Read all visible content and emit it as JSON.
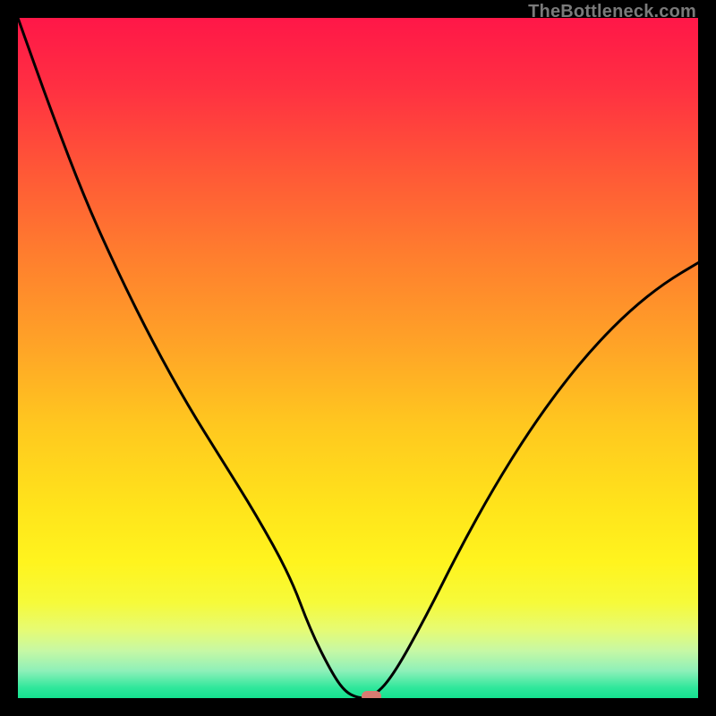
{
  "watermark": "TheBottleneck.com",
  "gradient": {
    "stops": [
      {
        "offset": 0.0,
        "color": "#ff1748"
      },
      {
        "offset": 0.1,
        "color": "#ff2f42"
      },
      {
        "offset": 0.22,
        "color": "#ff5637"
      },
      {
        "offset": 0.35,
        "color": "#ff7e2e"
      },
      {
        "offset": 0.48,
        "color": "#ffa327"
      },
      {
        "offset": 0.6,
        "color": "#ffc81f"
      },
      {
        "offset": 0.72,
        "color": "#ffe41b"
      },
      {
        "offset": 0.8,
        "color": "#fff41e"
      },
      {
        "offset": 0.86,
        "color": "#f6fa3a"
      },
      {
        "offset": 0.9,
        "color": "#e6fb74"
      },
      {
        "offset": 0.93,
        "color": "#c7f8a4"
      },
      {
        "offset": 0.96,
        "color": "#8ef0b9"
      },
      {
        "offset": 0.985,
        "color": "#2fe79b"
      },
      {
        "offset": 1.0,
        "color": "#14e28f"
      }
    ]
  },
  "chart_data": {
    "type": "line",
    "title": "",
    "xlabel": "",
    "ylabel": "",
    "xlim": [
      0,
      100
    ],
    "ylim": [
      0,
      100
    ],
    "x": [
      0,
      5,
      10,
      15,
      20,
      25,
      30,
      35,
      40,
      43,
      46,
      48,
      50,
      52,
      55,
      60,
      65,
      70,
      75,
      80,
      85,
      90,
      95,
      100
    ],
    "y": [
      100,
      86,
      73,
      62,
      52,
      43,
      35,
      27,
      18,
      10,
      4,
      1,
      0,
      0,
      3,
      12,
      22,
      31,
      39,
      46,
      52,
      57,
      61,
      64
    ],
    "flat_region": {
      "x_start": 48,
      "x_end": 52,
      "y": 0
    },
    "marker": {
      "x": 52,
      "y": 0,
      "color": "#d97b72"
    },
    "note": "y normalized so 0 = bottom (green band), 100 = top (red band). Curve descends from top-left, flattens at bottom near x≈48–52, rises again; left branch steeper/taller than right."
  },
  "curve_stroke": "#000000",
  "curve_width": 3
}
